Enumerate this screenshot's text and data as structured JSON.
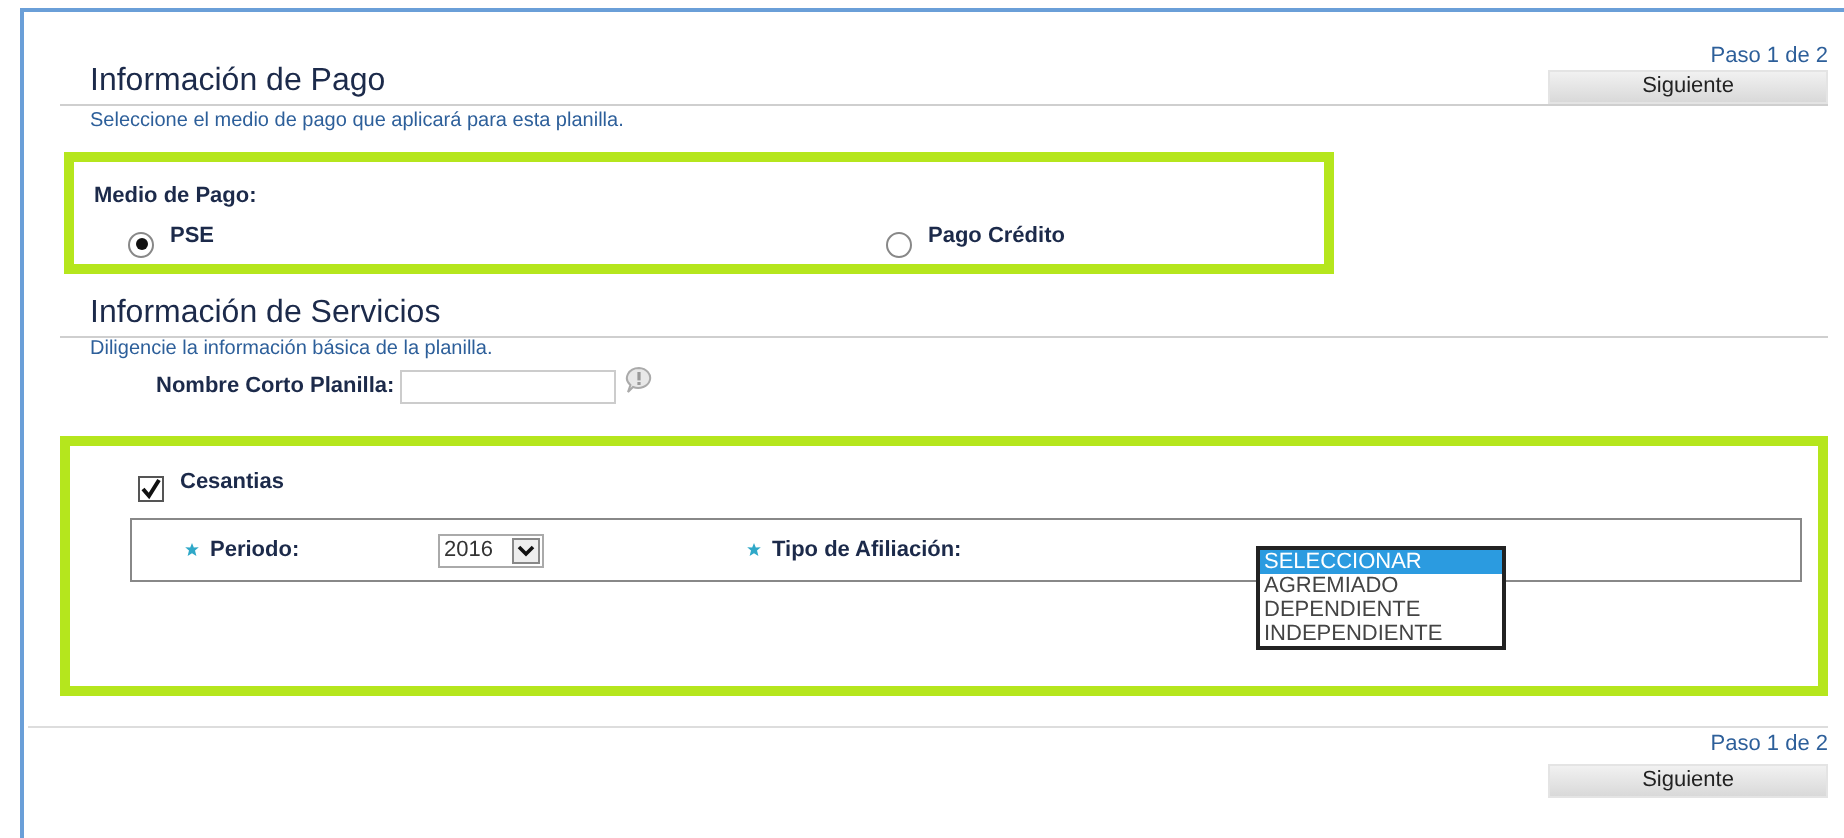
{
  "header": {
    "step": "Paso 1 de 2",
    "next_button": "Siguiente"
  },
  "payment": {
    "title": "Información de Pago",
    "description": "Seleccione el medio de pago que aplicará para esta planilla.",
    "group_label": "Medio de Pago:",
    "options": [
      {
        "label": "PSE",
        "selected": true
      },
      {
        "label": "Pago Crédito",
        "selected": false
      }
    ]
  },
  "services": {
    "title": "Información de Servicios",
    "description": "Diligencie la información básica de la planilla.",
    "short_name_label": "Nombre Corto Planilla:",
    "cesantias": {
      "label": "Cesantias",
      "checked": true,
      "period": {
        "label": "Periodo:",
        "required": true,
        "value": "2016"
      },
      "affiliation": {
        "label": "Tipo de Afiliación:",
        "required": true,
        "options": [
          {
            "label": "SELECCIONAR",
            "selected": true
          },
          {
            "label": "AGREMIADO",
            "selected": false
          },
          {
            "label": "DEPENDIENTE",
            "selected": false
          },
          {
            "label": "INDEPENDIENTE",
            "selected": false
          }
        ]
      }
    }
  },
  "footer": {
    "step": "Paso 1 de 2",
    "next_button": "Siguiente"
  }
}
